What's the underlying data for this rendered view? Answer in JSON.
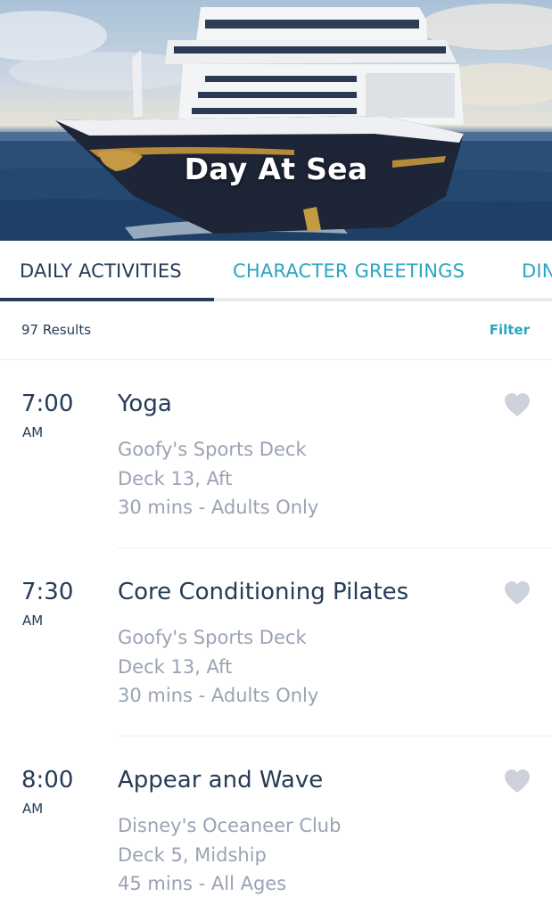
{
  "header": {
    "title": "Day At Sea"
  },
  "tabs": [
    {
      "label": "DAILY ACTIVITIES",
      "active": true
    },
    {
      "label": "CHARACTER GREETINGS",
      "active": false
    },
    {
      "label": "DIN",
      "active": false
    }
  ],
  "results": {
    "count_label": "97 Results",
    "filter_label": "Filter"
  },
  "activities": [
    {
      "time": "7:00",
      "ampm": "AM",
      "title": "Yoga",
      "location": "Goofy's Sports Deck",
      "deck": "Deck 13, Aft",
      "info": "30 mins - Adults Only",
      "favorite_icon": "heart-icon"
    },
    {
      "time": "7:30",
      "ampm": "AM",
      "title": "Core Conditioning Pilates",
      "location": "Goofy's Sports Deck",
      "deck": "Deck 13, Aft",
      "info": "30 mins - Adults Only",
      "favorite_icon": "heart-icon"
    },
    {
      "time": "8:00",
      "ampm": "AM",
      "title": "Appear and Wave",
      "location": "Disney's Oceaneer Club",
      "deck": "Deck 5, Midship",
      "info": "45 mins - All Ages",
      "favorite_icon": "heart-icon"
    }
  ],
  "colors": {
    "navy": "#253b56",
    "accent": "#2aa6c1",
    "muted": "#9aa3b3",
    "heart": "#ccd1dc"
  }
}
